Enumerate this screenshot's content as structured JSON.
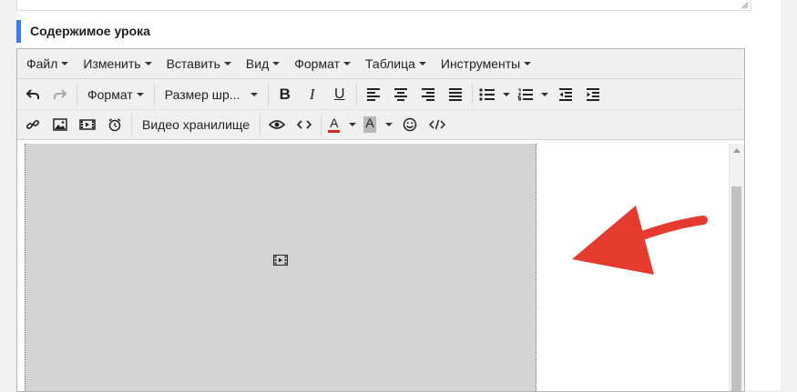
{
  "section": {
    "title": "Содержимое урока"
  },
  "menu": {
    "items": [
      {
        "label": "Файл",
        "name": "menu-file"
      },
      {
        "label": "Изменить",
        "name": "menu-edit"
      },
      {
        "label": "Вставить",
        "name": "menu-insert"
      },
      {
        "label": "Вид",
        "name": "menu-view"
      },
      {
        "label": "Формат",
        "name": "menu-format"
      },
      {
        "label": "Таблица",
        "name": "menu-table"
      },
      {
        "label": "Инструменты",
        "name": "menu-tools"
      }
    ]
  },
  "toolbar": {
    "format_select": "Формат",
    "font_size_select": "Размер шр...",
    "video_storage_label": "Видео хранилище",
    "bold_label": "B",
    "italic_label": "I",
    "underline_label": "U",
    "text_color_letter": "A",
    "bg_color_letter": "A",
    "text_color": "#d9261c",
    "bg_color": "#b8b8b8"
  },
  "colors": {
    "accent": "#3b7cf5",
    "arrow": "#e53a2e",
    "placeholder_bg": "#d4d4d4"
  }
}
